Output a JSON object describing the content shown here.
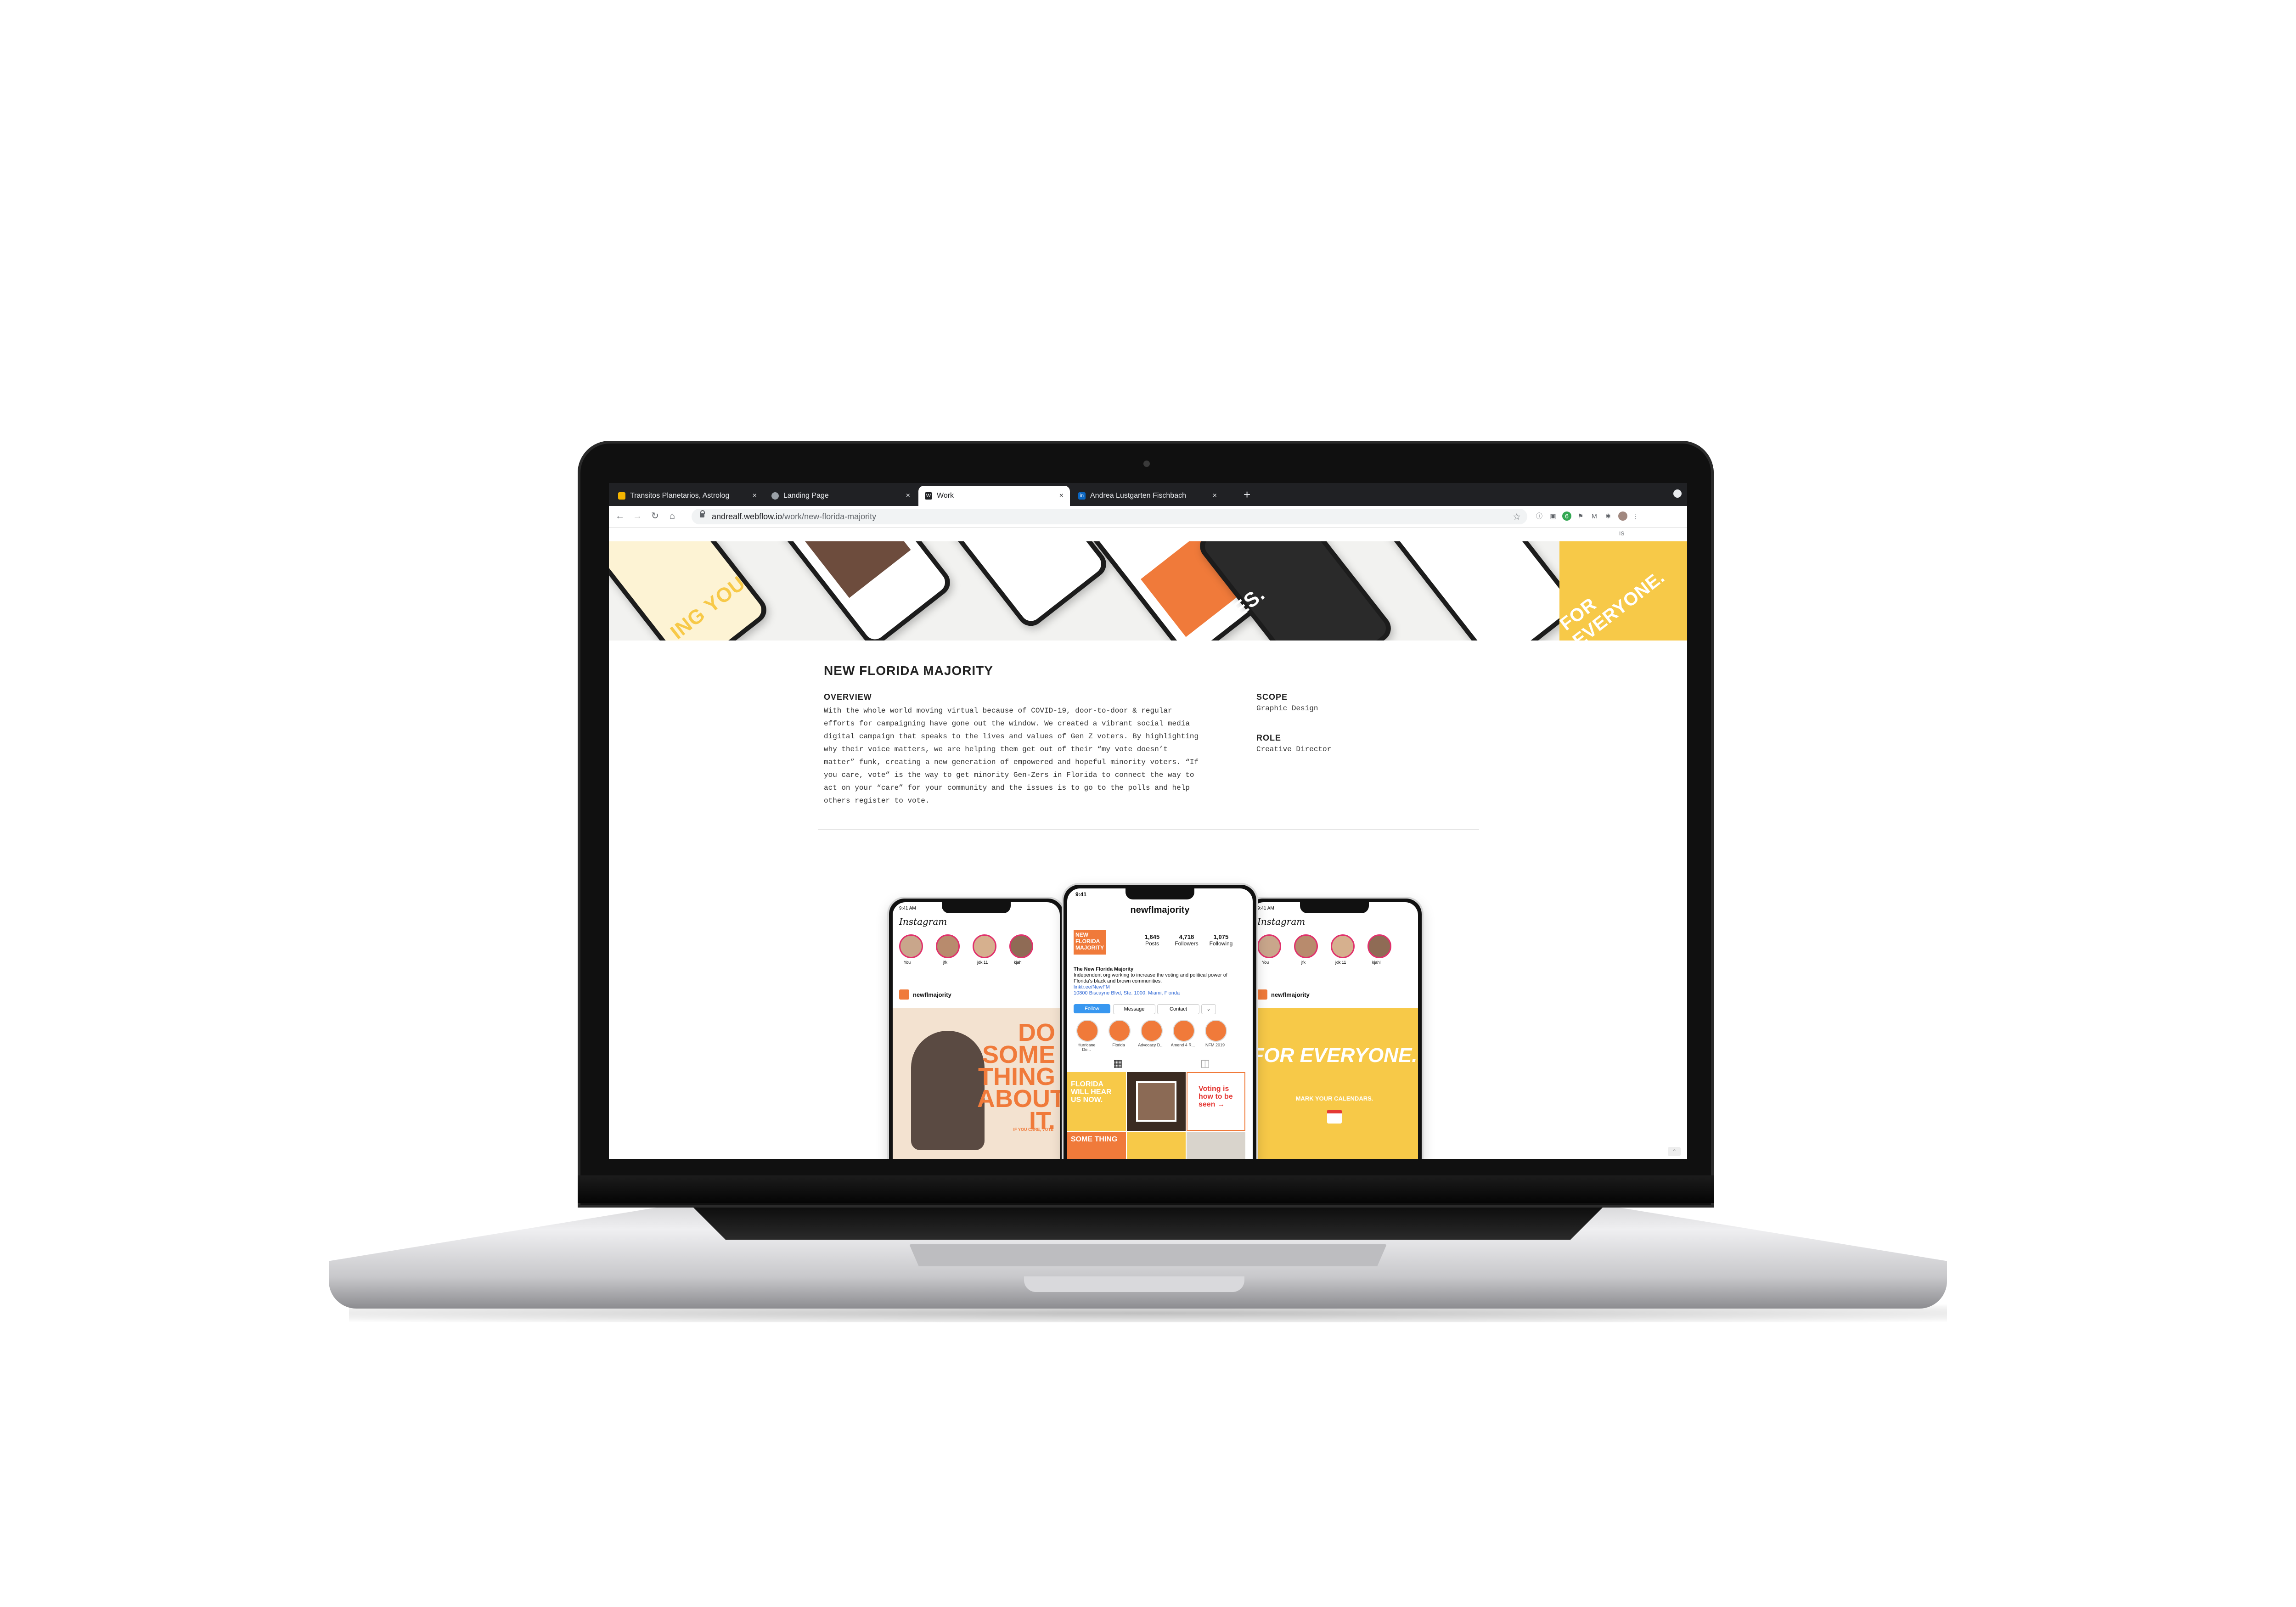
{
  "browser": {
    "tabs": [
      {
        "title": "Transitos Planetarios, Astrolog",
        "favicon_color": "#f4b400",
        "close": "×"
      },
      {
        "title": "Landing Page",
        "favicon_color": "#9aa0a6",
        "close": "×"
      },
      {
        "title": "Work",
        "favicon_color": "#202124",
        "favicon_letter": "W",
        "close": "×",
        "active": true
      },
      {
        "title": "Andrea Lustgarten Fischbach",
        "favicon_color": "#0a66c2",
        "favicon_letter": "in",
        "close": "×"
      }
    ],
    "new_tab": "+",
    "nav": {
      "back": "←",
      "forward": "→",
      "reload": "↻",
      "home": "⌂"
    },
    "url": {
      "host": "andrealf.webflow.io",
      "path": "/work/new-florida-majority"
    },
    "bookmark_star": "☆",
    "extensions": [
      "ⓘ",
      "▣",
      "6",
      "⚑",
      "M",
      "✱"
    ],
    "bookmarkbar_text": "IS",
    "menu": "⋮"
  },
  "page": {
    "title": "NEW FLORIDA MAJORITY",
    "overview": {
      "label": "OVERVIEW",
      "text": "With the whole world moving virtual because of COVID-19, door-to-door & regular efforts for campaigning have gone out the window. We created a vibrant social media digital campaign that speaks to the lives and values of Gen Z voters. By highlighting why their voice matters, we are helping them get out of their “my vote doesn’t matter” funk, creating a new generation of empowered and hopeful minority voters. “If you care, vote” is the way to get minority Gen-Zers in Florida to connect the way to act on your “care” for your community and the issues is to go to the polls and help others register to vote."
    },
    "scope": {
      "label": "SCOPE",
      "value": "Graphic Design"
    },
    "role": {
      "label": "ROLE",
      "value": "Creative Director"
    }
  },
  "hero": {
    "texts": [
      "FOR EVERYONE.",
      "ING YOU",
      "TIES."
    ],
    "colors": {
      "yellow": "#f7c948",
      "orange": "#f07a3a"
    }
  },
  "phones": {
    "left": {
      "time": "9:41 AM",
      "app": "Instagram",
      "story_names": [
        "You",
        "jfk",
        "jdk 11",
        "kjahl"
      ],
      "handle": "newflmajority",
      "post_text": "DO SOME THING ABOUT IT.",
      "post_caption": "IF YOU CARE, VOTE"
    },
    "center": {
      "time": "9:41",
      "username": "newflmajority",
      "logo_text": "NEW FLORIDA MAJORITY",
      "stats": [
        {
          "value": "1,645",
          "label": "Posts"
        },
        {
          "value": "4,718",
          "label": "Followers"
        },
        {
          "value": "1,075",
          "label": "Following"
        }
      ],
      "bio_name": "The New Florida Majority",
      "bio_text": "Independent org working to increase the voting and political power of Florida's black and brown communities.",
      "bio_link": "linktr.ee/NewFM",
      "bio_address": "10800 Biscayne Blvd, Ste. 1000, Miami, Florida",
      "buttons": [
        "Follow",
        "Message",
        "Contact",
        "⌄"
      ],
      "highlights": [
        "Hurricane De...",
        "Florida",
        "Advocacy D...",
        "Amend 4 R...",
        "NFM 2019"
      ],
      "grid_texts": [
        "FLORIDA WILL HEAR US NOW.",
        "Voting is how to be seen →",
        "SOME THING"
      ]
    },
    "right": {
      "time": "9:41 AM",
      "app": "Instagram",
      "story_names": [
        "You",
        "jfk",
        "jdk 11",
        "kjahl"
      ],
      "handle": "newflmajority",
      "post_big": "FOR EVERYONE.",
      "post_small": "MARK YOUR CALENDARS."
    }
  }
}
